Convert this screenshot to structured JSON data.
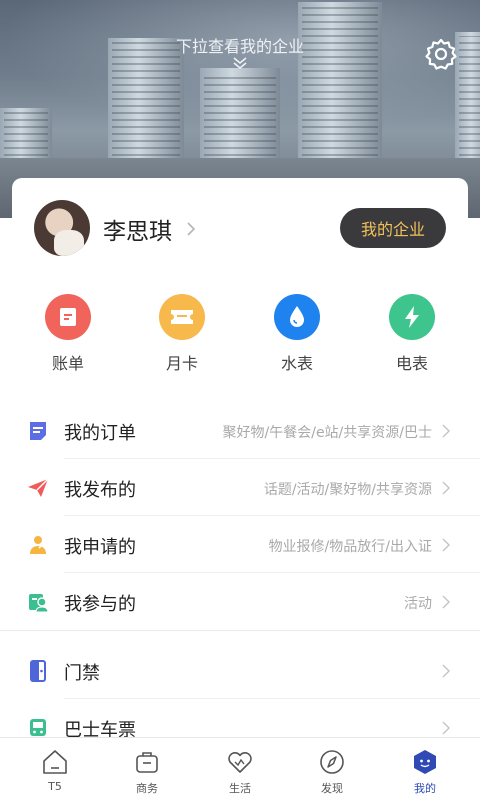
{
  "header": {
    "pull_hint": "下拉查看我的企业"
  },
  "profile": {
    "name": "李思琪",
    "my_company_label": "我的企业"
  },
  "quick_actions": [
    {
      "label": "账单",
      "color": "#f0645b",
      "icon": "bill-icon"
    },
    {
      "label": "月卡",
      "color": "#f7b94c",
      "icon": "ticket-icon"
    },
    {
      "label": "水表",
      "color": "#1e83ef",
      "icon": "water-drop-icon"
    },
    {
      "label": "电表",
      "color": "#3ec58e",
      "icon": "lightning-icon"
    }
  ],
  "menu": [
    {
      "label": "我的订单",
      "sub": "聚好物/午餐会/e站/共享资源/巴士",
      "icon": "order-doc-icon",
      "color": "#5b6ee6"
    },
    {
      "label": "我发布的",
      "sub": "话题/活动/聚好物/共享资源",
      "icon": "paper-plane-icon",
      "color": "#ef5a5a"
    },
    {
      "label": "我申请的",
      "sub": "物业报修/物品放行/出入证",
      "icon": "apply-person-icon",
      "color": "#f6b440"
    },
    {
      "label": "我参与的",
      "sub": "活动",
      "icon": "participate-icon",
      "color": "#3cbf90"
    },
    {
      "label": "门禁",
      "sub": "",
      "icon": "door-icon",
      "color": "#4f66d9"
    },
    {
      "label": "巴士车票",
      "sub": "",
      "icon": "bus-icon",
      "color": "#3cbf90"
    }
  ],
  "tabs": [
    {
      "label": "T5",
      "icon": "home-icon"
    },
    {
      "label": "商务",
      "icon": "briefcase-icon"
    },
    {
      "label": "生活",
      "icon": "heart-icon"
    },
    {
      "label": "发现",
      "icon": "compass-icon"
    },
    {
      "label": "我的",
      "icon": "profile-hex-icon",
      "active": true
    }
  ],
  "colors": {
    "accent": "#2f4ab4",
    "company_button_bg": "#3a3a3c",
    "company_button_text": "#f2c15c"
  }
}
